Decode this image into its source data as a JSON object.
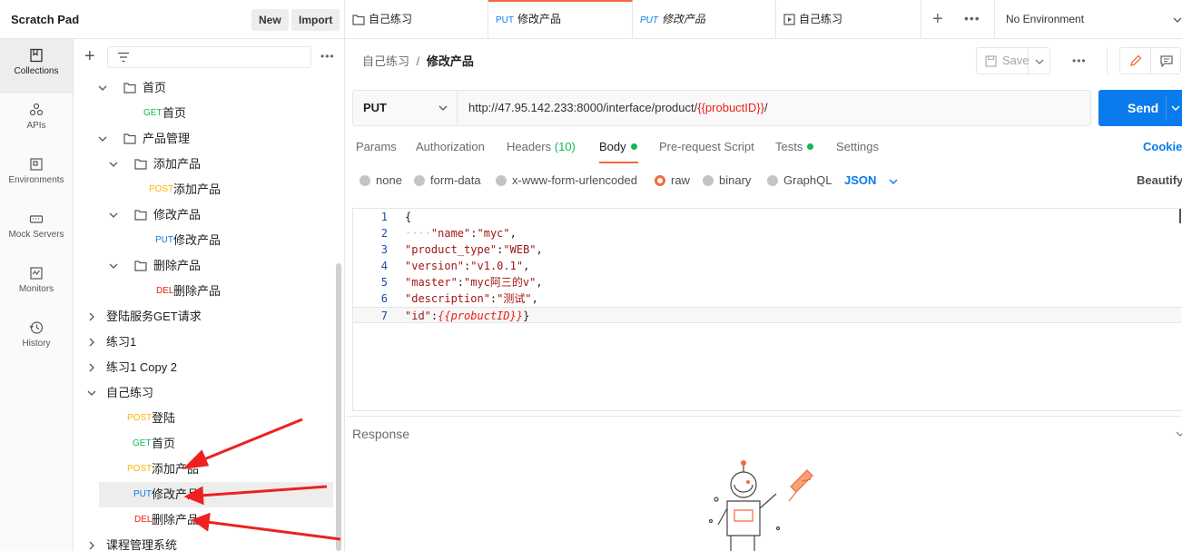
{
  "topbar": {
    "workspace": "Scratch Pad",
    "new_label": "New",
    "import_label": "Import",
    "tabs": [
      {
        "method": "",
        "title": "自己练习",
        "icon": "folder-icon"
      },
      {
        "method": "PUT",
        "title": "修改产品",
        "active": true
      },
      {
        "method": "PUT",
        "title": "修改产品",
        "italic": true
      },
      {
        "method": "",
        "title": "自己练习",
        "icon": "runner-icon"
      }
    ],
    "environment": "No Environment"
  },
  "nav": [
    {
      "label": "Collections",
      "icon": "collections-icon",
      "active": true
    },
    {
      "label": "APIs",
      "icon": "apis-icon"
    },
    {
      "label": "Environments",
      "icon": "environments-icon"
    },
    {
      "label": "Mock Servers",
      "icon": "mock-servers-icon"
    },
    {
      "label": "Monitors",
      "icon": "monitors-icon"
    },
    {
      "label": "History",
      "icon": "history-icon"
    }
  ],
  "tree": [
    {
      "type": "folder",
      "label": "首页",
      "depth": 1
    },
    {
      "type": "request",
      "method": "GET",
      "label": "首页",
      "depth": 2
    },
    {
      "type": "folder",
      "label": "产品管理",
      "depth": 1
    },
    {
      "type": "folder",
      "label": "添加产品",
      "depth": 2
    },
    {
      "type": "request",
      "method": "POST",
      "label": "添加产品",
      "depth": 3
    },
    {
      "type": "folder",
      "label": "修改产品",
      "depth": 2
    },
    {
      "type": "request",
      "method": "PUT",
      "label": "修改产品",
      "depth": 3
    },
    {
      "type": "folder",
      "label": "删除产品",
      "depth": 2
    },
    {
      "type": "request",
      "method": "DEL",
      "label": "删除产品",
      "depth": 3
    },
    {
      "type": "collection",
      "label": "登陆服务GET请求",
      "depth": 0,
      "collapsed": true
    },
    {
      "type": "collection",
      "label": "练习1",
      "depth": 0,
      "collapsed": true
    },
    {
      "type": "collection",
      "label": "练习1 Copy 2",
      "depth": 0,
      "collapsed": true
    },
    {
      "type": "collection",
      "label": "自己练习",
      "depth": 0,
      "collapsed": false
    },
    {
      "type": "request",
      "method": "POST",
      "label": "登陆",
      "depth": 1
    },
    {
      "type": "request",
      "method": "GET",
      "label": "首页",
      "depth": 1
    },
    {
      "type": "request",
      "method": "POST",
      "label": "添加产品",
      "depth": 1
    },
    {
      "type": "request",
      "method": "PUT",
      "label": "修改产品",
      "depth": 1,
      "selected": true
    },
    {
      "type": "request",
      "method": "DEL",
      "label": "删除产品",
      "depth": 1
    },
    {
      "type": "collection",
      "label": "课程管理系统",
      "depth": 0,
      "collapsed": true
    }
  ],
  "request": {
    "breadcrumb_parent": "自己练习",
    "breadcrumb_sep": "/",
    "breadcrumb_current": "修改产品",
    "save_label": "Save",
    "method": "PUT",
    "url_prefix": "http://47.95.142.233:8000/interface/product/",
    "url_variable": "{{probuctID}}",
    "url_suffix": "/",
    "send_label": "Send",
    "tabs": {
      "params": "Params",
      "authorization": "Authorization",
      "headers": "Headers",
      "headers_count": "(10)",
      "body": "Body",
      "prerequest": "Pre-request Script",
      "tests": "Tests",
      "settings": "Settings",
      "cookies": "Cookies"
    },
    "body_options": {
      "none": "none",
      "form_data": "form-data",
      "urlencoded": "x-www-form-urlencoded",
      "raw": "raw",
      "binary": "binary",
      "graphql": "GraphQL",
      "format": "JSON",
      "beautify": "Beautify"
    },
    "code_lines": [
      {
        "n": "1",
        "text": "{"
      },
      {
        "n": "2",
        "ws": "····",
        "key": "\"name\"",
        "colon": ":",
        "val": "\"myc\"",
        "end": ","
      },
      {
        "n": "3",
        "key": "\"product_type\"",
        "colon": ":",
        "val": "\"WEB\"",
        "end": ","
      },
      {
        "n": "4",
        "key": "\"version\"",
        "colon": ":",
        "val": "\"v1.0.1\"",
        "end": ","
      },
      {
        "n": "5",
        "key": "\"master\"",
        "colon": ":",
        "val": "\"myc阿三的v\"",
        "end": ","
      },
      {
        "n": "6",
        "key": "\"description\"",
        "colon": ":",
        "val": "\"测试\"",
        "end": ","
      },
      {
        "n": "7",
        "key": "\"id\"",
        "colon": ":",
        "var": "{{probuctID}}",
        "end": "}"
      }
    ],
    "response_label": "Response"
  }
}
